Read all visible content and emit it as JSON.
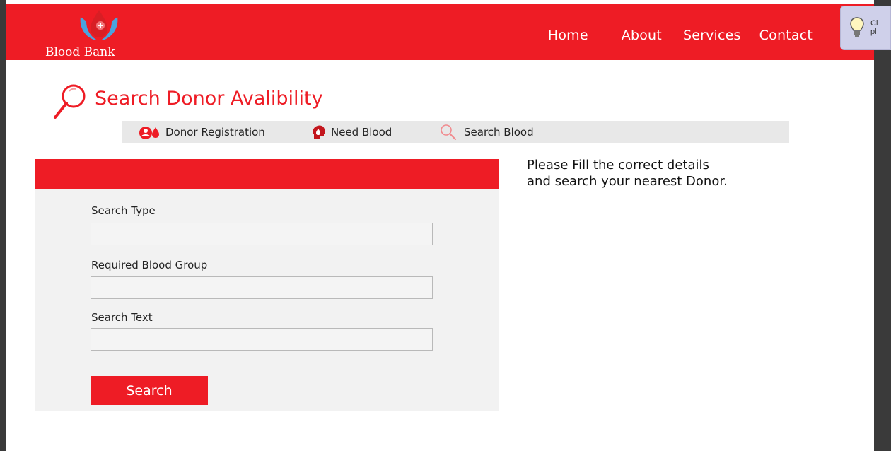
{
  "brand": {
    "name": "Blood Bank",
    "accent": "#ee1c25",
    "logo_icon": "blood-drop-hands-icon"
  },
  "nav": {
    "items": [
      {
        "label": "Home"
      },
      {
        "label": "About"
      },
      {
        "label": "Services"
      },
      {
        "label": "Contact"
      }
    ]
  },
  "tip": {
    "icon": "lightbulb-icon",
    "text_line1": "Cl",
    "text_line2": "pl"
  },
  "page": {
    "title": "Search Donor Avalibility",
    "title_icon": "magnifier-icon"
  },
  "subnav": {
    "items": [
      {
        "label": "Donor Registration",
        "icon": "donor-icon"
      },
      {
        "label": "Need Blood",
        "icon": "head-drop-icon"
      },
      {
        "label": "Search Blood",
        "icon": "magnifier-icon"
      }
    ]
  },
  "form": {
    "fields": [
      {
        "label": "Search Type",
        "value": "",
        "placeholder": ""
      },
      {
        "label": "Required Blood Group",
        "value": "",
        "placeholder": ""
      },
      {
        "label": "Search Text",
        "value": "",
        "placeholder": ""
      }
    ],
    "submit_label": "Search"
  },
  "help": {
    "line1": "Please Fill the correct details",
    "line2": "and search your nearest Donor."
  }
}
